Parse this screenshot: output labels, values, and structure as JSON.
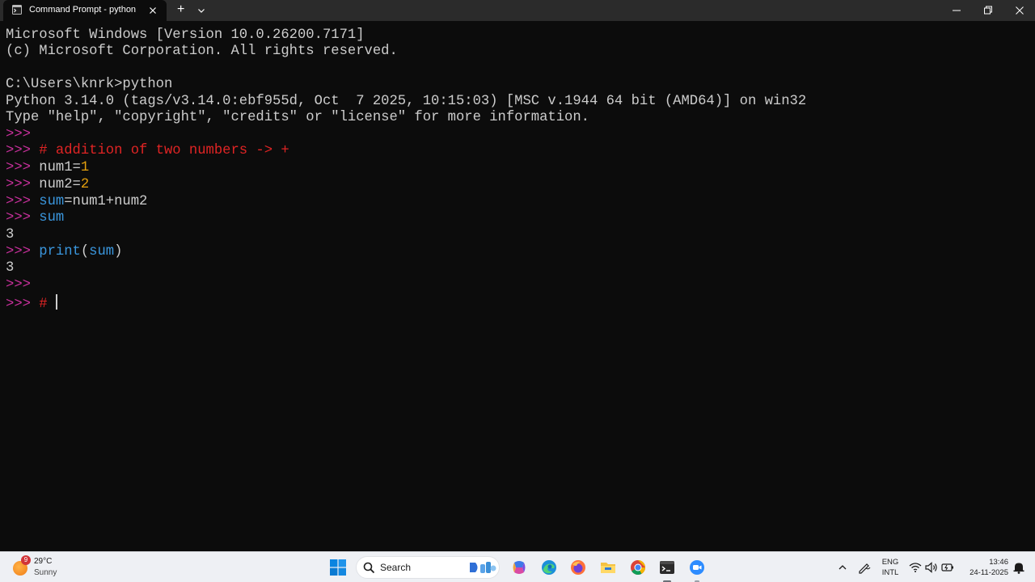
{
  "window": {
    "tab_title": "Command Prompt - python",
    "new_tab_glyph": "+",
    "dropdown_icon": "chevron-down-icon",
    "controls": [
      "minimize-icon",
      "maximize-icon",
      "close-icon"
    ]
  },
  "terminal": {
    "banner": {
      "line1": "Microsoft Windows [Version 10.0.26200.7171]",
      "line2": "(c) Microsoft Corporation. All rights reserved."
    },
    "shell_prompt": "C:\\Users\\knrk>",
    "shell_command": "python",
    "python_info1": "Python 3.14.0 (tags/v3.14.0:ebf955d, Oct  7 2025, 10:15:03) [MSC v.1944 64 bit (AMD64)] on win32",
    "python_info2": "Type \"help\", \"copyright\", \"credits\" or \"license\" for more information.",
    "repl_prompt": ">>> ",
    "comment": "# addition of two numbers -> +",
    "assign1": {
      "name": "num1",
      "op": "=",
      "value": "1"
    },
    "assign2": {
      "name": "num2",
      "op": "=",
      "value": "2"
    },
    "assign3": {
      "name": "sum",
      "op": "=",
      "expr": "num1+num2"
    },
    "eval_name": "sum",
    "output1": "3",
    "print_call": {
      "func": "print",
      "open": "(",
      "arg": "sum",
      "close": ")"
    },
    "output2": "3",
    "current_input": "# ",
    "colors": {
      "text": "#cccccc",
      "prompt": "#c8309c",
      "comment": "#e02424",
      "number": "#e5a00d",
      "identifier": "#3a96dd",
      "background": "#0c0c0c"
    }
  },
  "taskbar": {
    "weather": {
      "badge": "9",
      "temp": "29°C",
      "condition": "Sunny",
      "icon": "sun-icon"
    },
    "search_label": "Search",
    "apps": [
      "windows-start-icon",
      "search-icon",
      "copilot-icon",
      "edge-icon",
      "firefox-icon",
      "file-explorer-icon",
      "chrome-icon",
      "terminal-icon",
      "zoom-icon"
    ],
    "tray": {
      "lang_line1": "ENG",
      "lang_line2": "INTL",
      "time": "13:46",
      "date": "24-11-2025",
      "icons": [
        "chevron-up-icon",
        "pen-icon",
        "wifi-icon",
        "volume-icon",
        "battery-icon",
        "notification-icon"
      ]
    }
  }
}
